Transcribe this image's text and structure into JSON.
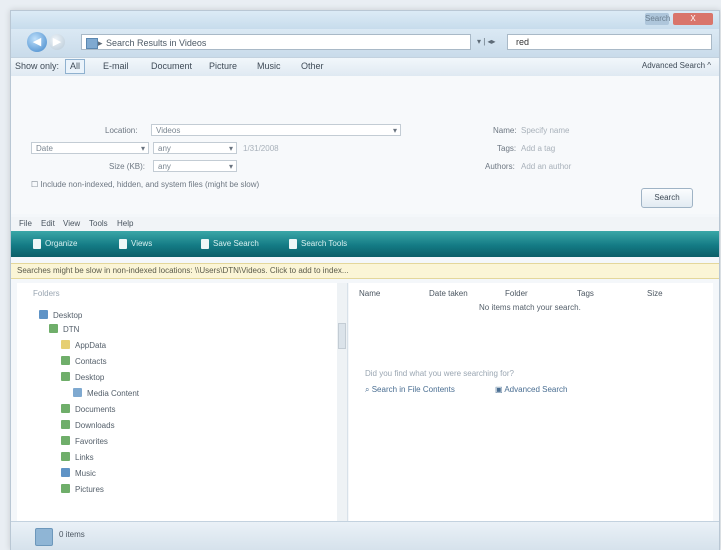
{
  "window": {
    "min_label": "Search",
    "close_label": "X"
  },
  "address_bar": {
    "path": "Search Results in Videos",
    "recent_label": "▾ | ◂▸",
    "search_value": "red"
  },
  "filters": {
    "items": [
      "Show only:",
      "All",
      "E-mail",
      "Document",
      "Picture",
      "Music",
      "Other"
    ],
    "advanced_label": "Advanced Search ^"
  },
  "advanced": {
    "location_label": "Location:",
    "location_value": "Videos",
    "date_label": "Date",
    "date_op": "any",
    "date_hint": "1/31/2008",
    "size_label": "Size (KB):",
    "size_op": "any",
    "include_label": "Include non-indexed, hidden, and system files (might be slow)",
    "name_label": "Name:",
    "name_hint": "Specify name",
    "tags_label": "Tags:",
    "tags_hint": "Add a tag",
    "authors_label": "Authors:",
    "authors_hint": "Add an author",
    "search_button": "Search"
  },
  "menubar": [
    "File",
    "Edit",
    "View",
    "Tools",
    "Help"
  ],
  "toolbar": [
    "Organize",
    "Views",
    "Save Search",
    "Search Tools"
  ],
  "infobar": "Searches might be slow in non-indexed locations: \\\\Users\\DTN\\Videos. Click to add to index...",
  "nav": {
    "header": "Folders",
    "items": [
      "Desktop",
      "DTN",
      "AppData",
      "Contacts",
      "Desktop",
      "Media Content",
      "Documents",
      "Downloads",
      "Favorites",
      "Links",
      "Music",
      "Pictures"
    ]
  },
  "content": {
    "columns": [
      "Name",
      "Date taken",
      "Folder",
      "Tags",
      "Size"
    ],
    "no_match": "No items match your search.",
    "question": "Did you find what you were searching for?",
    "link_contents": "Search in File Contents",
    "link_advanced": "Advanced Search"
  },
  "status": {
    "count": "0 items"
  },
  "colors": {
    "toolbar": "#147b85",
    "infobar": "#fbf5d6"
  }
}
